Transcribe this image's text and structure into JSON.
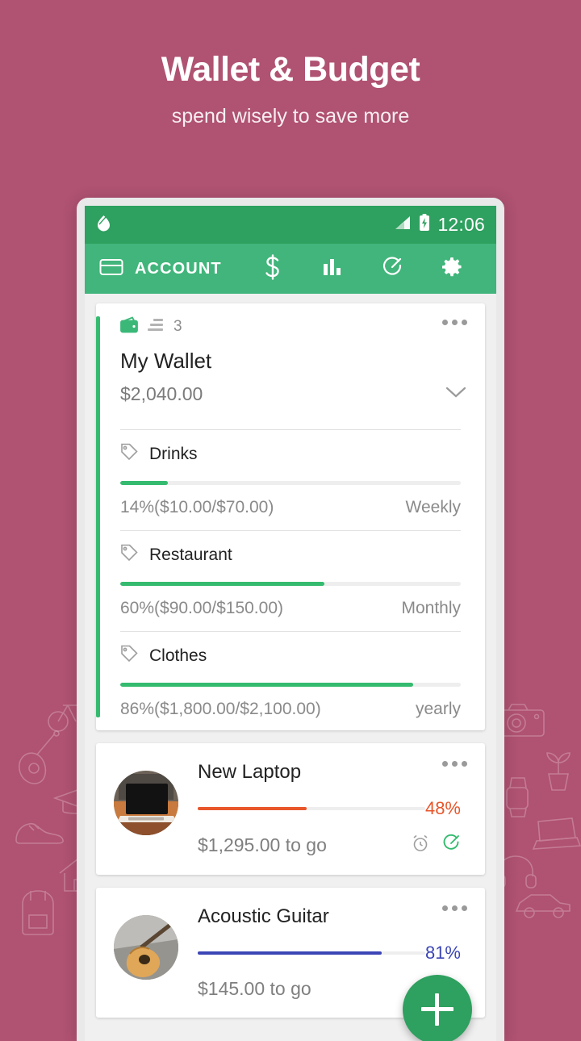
{
  "promo": {
    "title": "Wallet & Budget",
    "subtitle": "spend wisely to save more"
  },
  "colors": {
    "background": "#b05272",
    "statusbar": "#2ea05f",
    "appbar": "#41b57b",
    "accent_green": "#35bb6f",
    "goal_orange": "#e8562b",
    "goal_blue": "#3b45b5",
    "fab": "#2ea05f"
  },
  "statusbar": {
    "app_icon": "app-notification-icon",
    "signal_icon": "signal-icon",
    "battery_icon": "battery-charging-icon",
    "time": "12:06"
  },
  "appbar": {
    "account_tab": {
      "icon": "credit-card-icon",
      "label": "ACCOUNT"
    },
    "tabs": [
      {
        "icon": "dollar-icon",
        "name": "transactions"
      },
      {
        "icon": "bar-chart-icon",
        "name": "reports"
      },
      {
        "icon": "target-icon",
        "name": "goals"
      },
      {
        "icon": "gear-icon",
        "name": "settings"
      }
    ]
  },
  "wallet_card": {
    "wallet_icon": "wallet-icon",
    "accounts_icon": "accounts-list-icon",
    "accounts_count": "3",
    "overflow_icon": "overflow-menu-icon",
    "name": "My Wallet",
    "balance": "$2,040.00",
    "expand_icon": "chevron-down-icon",
    "budgets": [
      {
        "tag_icon": "tag-icon",
        "name": "Drinks",
        "percent": 14,
        "amount": "14%($10.00/$70.00)",
        "period": "Weekly"
      },
      {
        "tag_icon": "tag-icon",
        "name": "Restaurant",
        "percent": 60,
        "amount": "60%($90.00/$150.00)",
        "period": "Monthly"
      },
      {
        "tag_icon": "tag-icon",
        "name": "Clothes",
        "percent": 86,
        "amount": "86%($1,800.00/$2,100.00)",
        "period": "yearly"
      }
    ]
  },
  "goals": [
    {
      "thumb": "laptop-photo",
      "title": "New Laptop",
      "percent": 48,
      "percent_label": "48%",
      "color": "#e8562b",
      "remaining": "$1,295.00 to go",
      "overflow_icon": "overflow-menu-icon",
      "actions": [
        {
          "icon": "alarm-clock-icon",
          "name": "reminder"
        },
        {
          "icon": "target-check-icon",
          "name": "goal-status"
        }
      ]
    },
    {
      "thumb": "guitar-photo",
      "title": "Acoustic Guitar",
      "percent": 81,
      "percent_label": "81%",
      "color": "#3b45b5",
      "remaining": "$145.00 to go",
      "overflow_icon": "overflow-menu-icon",
      "actions": []
    }
  ],
  "fab": {
    "icon": "plus-icon",
    "name": "add-button"
  }
}
